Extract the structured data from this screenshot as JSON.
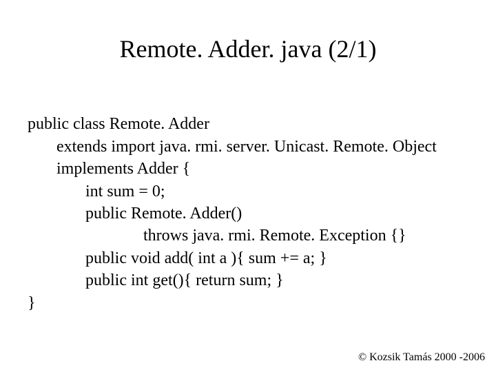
{
  "title": "Remote. Adder. java (2/1)",
  "code": {
    "l0": "public class Remote. Adder",
    "l1": "       extends import java. rmi. server. Unicast. Remote. Object",
    "l2": "       implements Adder {",
    "l3": "              int sum = 0;",
    "l4": "              public Remote. Adder()",
    "l5": "                            throws java. rmi. Remote. Exception {}",
    "l6": "              public void add( int a ){ sum += a; }",
    "l7": "              public int get(){ return sum; }",
    "l8": "}"
  },
  "copyright": "© Kozsik Tamás 2000 -2006"
}
